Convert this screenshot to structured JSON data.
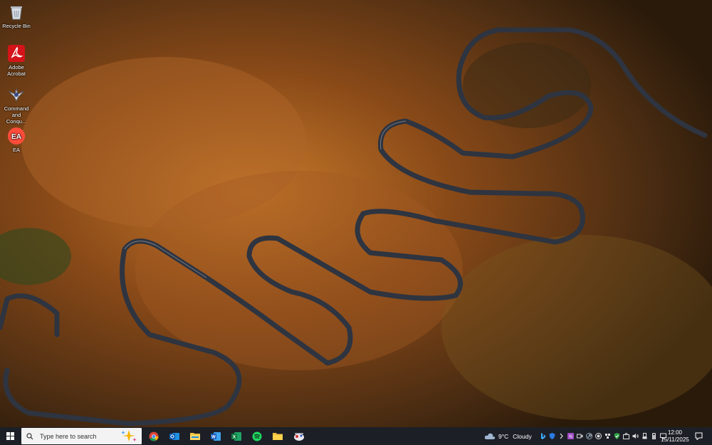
{
  "desktop_icons": [
    {
      "label": "Recycle Bin",
      "icon": "recycle-bin-icon"
    },
    {
      "label": "Adobe Acrobat",
      "icon": "adobe-acrobat-icon"
    },
    {
      "label": "Command and Conqu...",
      "icon": "command-and-conquer-icon"
    },
    {
      "label": "EA",
      "icon": "ea-app-icon"
    }
  ],
  "taskbar": {
    "search_placeholder": "Type here to search",
    "apps": [
      "chrome-icon",
      "outlook-icon",
      "file-explorer-icon",
      "word-icon",
      "excel-icon",
      "spotify-icon",
      "folder-icon",
      "game-app-icon"
    ],
    "weather": {
      "temp": "9°C",
      "condition": "Cloudy"
    },
    "clock": {
      "time": "12:00",
      "date": "15/11/2025"
    }
  },
  "colors": {
    "taskbar": "#1c1f26",
    "search_bg": "#f3f3f3",
    "road": "#2e3440",
    "accent": "#0078d4"
  }
}
